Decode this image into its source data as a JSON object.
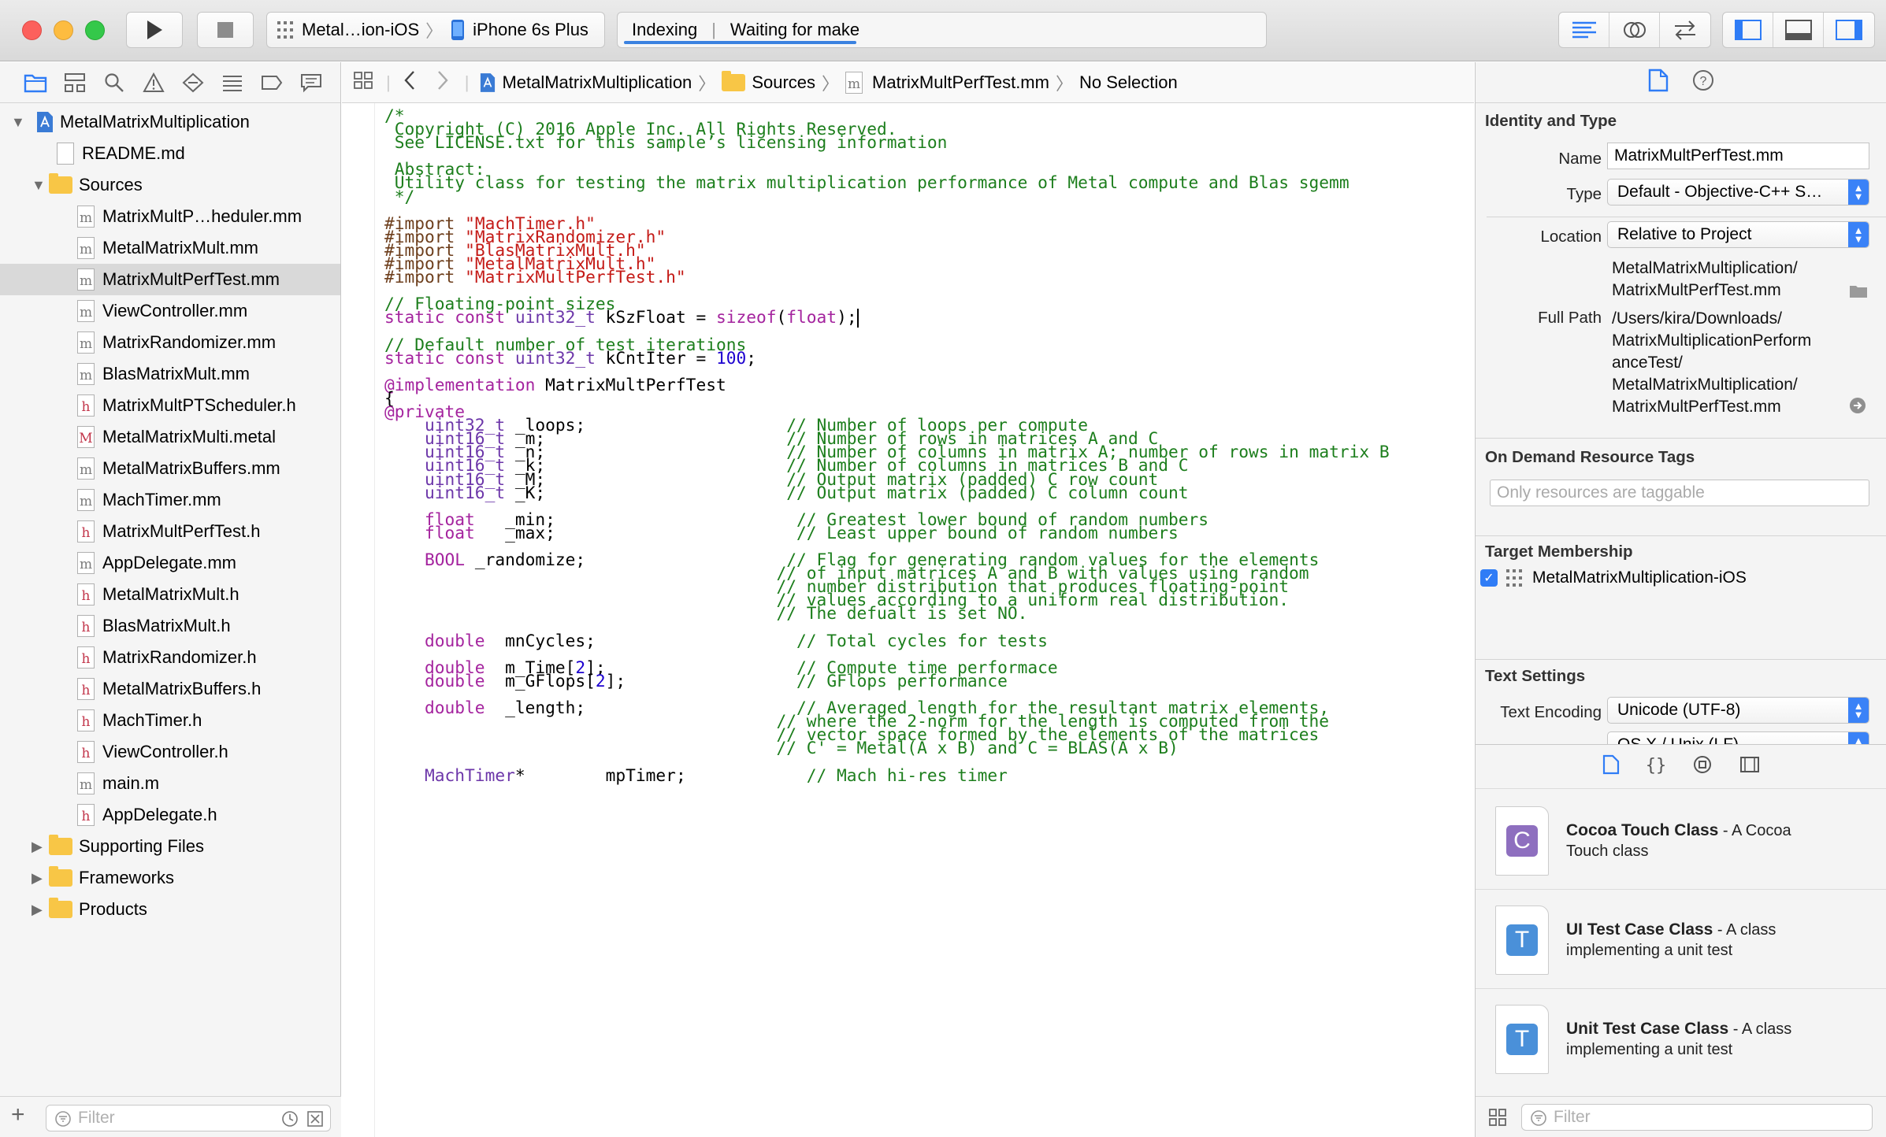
{
  "toolbar": {
    "scheme_name": "Metal…ion-iOS",
    "device_name": "iPhone 6s Plus",
    "status_left": "Indexing",
    "status_right": "Waiting for make"
  },
  "navigator": {
    "project": "MetalMatrixMultiplication",
    "readme": "README.md",
    "sources_folder": "Sources",
    "files": [
      {
        "name": "MatrixMultP…heduler.mm",
        "kind": "m"
      },
      {
        "name": "MetalMatrixMult.mm",
        "kind": "m"
      },
      {
        "name": "MatrixMultPerfTest.mm",
        "kind": "m",
        "selected": true
      },
      {
        "name": "ViewController.mm",
        "kind": "m"
      },
      {
        "name": "MatrixRandomizer.mm",
        "kind": "m"
      },
      {
        "name": "BlasMatrixMult.mm",
        "kind": "m"
      },
      {
        "name": "MatrixMultPTScheduler.h",
        "kind": "h"
      },
      {
        "name": "MetalMatrixMulti.metal",
        "kind": "metal"
      },
      {
        "name": "MetalMatrixBuffers.mm",
        "kind": "m"
      },
      {
        "name": "MachTimer.mm",
        "kind": "m"
      },
      {
        "name": "MatrixMultPerfTest.h",
        "kind": "h"
      },
      {
        "name": "AppDelegate.mm",
        "kind": "m"
      },
      {
        "name": "MetalMatrixMult.h",
        "kind": "h"
      },
      {
        "name": "BlasMatrixMult.h",
        "kind": "h"
      },
      {
        "name": "MatrixRandomizer.h",
        "kind": "h"
      },
      {
        "name": "MetalMatrixBuffers.h",
        "kind": "h"
      },
      {
        "name": "MachTimer.h",
        "kind": "h"
      },
      {
        "name": "ViewController.h",
        "kind": "h"
      },
      {
        "name": "main.m",
        "kind": "m"
      },
      {
        "name": "AppDelegate.h",
        "kind": "h"
      }
    ],
    "groups": [
      "Supporting Files",
      "Frameworks",
      "Products"
    ],
    "filter_placeholder": "Filter"
  },
  "jumpbar": {
    "project": "MetalMatrixMultiplication",
    "folder": "Sources",
    "file": "MatrixMultPerfTest.mm",
    "selection": "No Selection"
  },
  "editor": {
    "lines": [
      [
        [
          "cm",
          "/*"
        ]
      ],
      [
        [
          "cm",
          " Copyright (C) 2016 Apple Inc. All Rights Reserved."
        ]
      ],
      [
        [
          "cm",
          " See LICENSE.txt for this sample’s licensing information"
        ]
      ],
      [
        [
          "cm",
          " "
        ]
      ],
      [
        [
          "cm",
          " Abstract:"
        ]
      ],
      [
        [
          "cm",
          " Utility class for testing the matrix multiplication performance of Metal compute and Blas sgemm"
        ]
      ],
      [
        [
          "cm",
          " */"
        ]
      ],
      [
        [
          "",
          ""
        ]
      ],
      [
        [
          "pp",
          "#import "
        ],
        [
          "st",
          "\"MachTimer.h\""
        ]
      ],
      [
        [
          "pp",
          "#import "
        ],
        [
          "st",
          "\"MatrixRandomizer.h\""
        ]
      ],
      [
        [
          "pp",
          "#import "
        ],
        [
          "st",
          "\"BlasMatrixMult.h\""
        ]
      ],
      [
        [
          "pp",
          "#import "
        ],
        [
          "st",
          "\"MetalMatrixMult.h\""
        ]
      ],
      [
        [
          "pp",
          "#import "
        ],
        [
          "st",
          "\"MatrixMultPerfTest.h\""
        ]
      ],
      [
        [
          "",
          ""
        ]
      ],
      [
        [
          "cm",
          "// Floating-point sizes"
        ]
      ],
      [
        [
          "kw",
          "static const "
        ],
        [
          "ty",
          "uint32_t"
        ],
        [
          "",
          " kSzFloat = "
        ],
        [
          "kw",
          "sizeof"
        ],
        [
          "",
          "("
        ],
        [
          "kw",
          "float"
        ],
        [
          "",
          ");"
        ],
        [
          "cursor",
          ""
        ]
      ],
      [
        [
          "",
          ""
        ]
      ],
      [
        [
          "cm",
          "// Default number of test iterations"
        ]
      ],
      [
        [
          "kw",
          "static const "
        ],
        [
          "ty",
          "uint32_t"
        ],
        [
          "",
          " kCntIter = "
        ],
        [
          "nm",
          "100"
        ],
        [
          "",
          ";"
        ]
      ],
      [
        [
          "",
          ""
        ]
      ],
      [
        [
          "kw",
          "@implementation"
        ],
        [
          "",
          " MatrixMultPerfTest"
        ]
      ],
      [
        [
          "",
          "{"
        ]
      ],
      [
        [
          "kw",
          "@private"
        ]
      ],
      [
        [
          "",
          "    "
        ],
        [
          "ty",
          "uint32_t"
        ],
        [
          "",
          " _loops;                    "
        ],
        [
          "cm",
          "// Number of loops per compute"
        ]
      ],
      [
        [
          "",
          "    "
        ],
        [
          "ty",
          "uint16_t"
        ],
        [
          "",
          " _m;                        "
        ],
        [
          "cm",
          "// Number of rows in matrices A and C"
        ]
      ],
      [
        [
          "",
          "    "
        ],
        [
          "ty",
          "uint16_t"
        ],
        [
          "",
          " _n;                        "
        ],
        [
          "cm",
          "// Number of columns in matrix A; number of rows in matrix B"
        ]
      ],
      [
        [
          "",
          "    "
        ],
        [
          "ty",
          "uint16_t"
        ],
        [
          "",
          " _k;                        "
        ],
        [
          "cm",
          "// Number of columns in matrices B and C"
        ]
      ],
      [
        [
          "",
          "    "
        ],
        [
          "ty",
          "uint16_t"
        ],
        [
          "",
          " _M;                        "
        ],
        [
          "cm",
          "// Output matrix (padded) C row count"
        ]
      ],
      [
        [
          "",
          "    "
        ],
        [
          "ty",
          "uint16_t"
        ],
        [
          "",
          " _K;                        "
        ],
        [
          "cm",
          "// Output matrix (padded) C column count"
        ]
      ],
      [
        [
          "",
          ""
        ]
      ],
      [
        [
          "",
          "    "
        ],
        [
          "kw",
          "float"
        ],
        [
          "",
          "   _min;                        "
        ],
        [
          "cm",
          "// Greatest lower bound of random numbers"
        ]
      ],
      [
        [
          "",
          "    "
        ],
        [
          "kw",
          "float"
        ],
        [
          "",
          "   _max;                        "
        ],
        [
          "cm",
          "// Least upper bound of random numbers"
        ]
      ],
      [
        [
          "",
          ""
        ]
      ],
      [
        [
          "",
          "    "
        ],
        [
          "kw",
          "BOOL"
        ],
        [
          "",
          " _randomize;                    "
        ],
        [
          "cm",
          "// Flag for generating random values for the elements"
        ]
      ],
      [
        [
          "",
          "                                       "
        ],
        [
          "cm",
          "// of input matrices A and B with values using random"
        ]
      ],
      [
        [
          "",
          "                                       "
        ],
        [
          "cm",
          "// number distribution that produces floating-point"
        ]
      ],
      [
        [
          "",
          "                                       "
        ],
        [
          "cm",
          "// values according to a uniform real distribution."
        ]
      ],
      [
        [
          "",
          "                                       "
        ],
        [
          "cm",
          "// The defualt is set NO."
        ]
      ],
      [
        [
          "",
          ""
        ]
      ],
      [
        [
          "",
          "    "
        ],
        [
          "kw",
          "double"
        ],
        [
          "",
          "  mnCycles;                    "
        ],
        [
          "cm",
          "// Total cycles for tests"
        ]
      ],
      [
        [
          "",
          ""
        ]
      ],
      [
        [
          "",
          "    "
        ],
        [
          "kw",
          "double"
        ],
        [
          "",
          "  m_Time["
        ],
        [
          "nm",
          "2"
        ],
        [
          "",
          "];                   "
        ],
        [
          "cm",
          "// Compute time performace"
        ]
      ],
      [
        [
          "",
          "    "
        ],
        [
          "kw",
          "double"
        ],
        [
          "",
          "  m_GFlops["
        ],
        [
          "nm",
          "2"
        ],
        [
          "",
          "];                 "
        ],
        [
          "cm",
          "// GFlops performance"
        ]
      ],
      [
        [
          "",
          ""
        ]
      ],
      [
        [
          "",
          "    "
        ],
        [
          "kw",
          "double"
        ],
        [
          "",
          "  _length;                     "
        ],
        [
          "cm",
          "// Averaged length for the resultant matrix elements,"
        ]
      ],
      [
        [
          "",
          "                                       "
        ],
        [
          "cm",
          "// where the 2-norm for the length is computed from the"
        ]
      ],
      [
        [
          "",
          "                                       "
        ],
        [
          "cm",
          "// vector space formed by the elements of the matrices"
        ]
      ],
      [
        [
          "",
          "                                       "
        ],
        [
          "cm",
          "// C' = Metal(A x B) and C = BLAS(A x B)"
        ]
      ],
      [
        [
          "",
          ""
        ]
      ],
      [
        [
          "",
          "    "
        ],
        [
          "ty",
          "MachTimer"
        ],
        [
          "",
          "*        mpTimer;            "
        ],
        [
          "cm",
          "// Mach hi-res timer"
        ]
      ]
    ]
  },
  "inspector": {
    "identity_title": "Identity and Type",
    "name_label": "Name",
    "name_value": "MatrixMultPerfTest.mm",
    "type_label": "Type",
    "type_value": "Default - Objective-C++ S…",
    "location_label": "Location",
    "location_value": "Relative to Project",
    "location_path_1": "MetalMatrixMultiplication/",
    "location_path_2": "MatrixMultPerfTest.mm",
    "fullpath_label": "Full Path",
    "fullpath_lines": [
      "/Users/kira/Downloads/",
      "MatrixMultiplicationPerform",
      "anceTest/",
      "MetalMatrixMultiplication/",
      "MatrixMultPerfTest.mm"
    ],
    "odr_title": "On Demand Resource Tags",
    "odr_placeholder": "Only resources are taggable",
    "target_title": "Target Membership",
    "target_name": "MetalMatrixMultiplication-iOS",
    "text_title": "Text Settings",
    "encoding_label": "Text Encoding",
    "encoding_value": "Unicode (UTF-8)",
    "line_endings_partial": "OS X / Unix (LF)"
  },
  "library": {
    "items": [
      {
        "title": "Cocoa Touch Class",
        "desc": " - A Cocoa Touch class",
        "letter": "C",
        "color": "#8e6fbf"
      },
      {
        "title": "UI Test Case Class",
        "desc": " - A class implementing a unit test",
        "letter": "T",
        "color": "#4a90d9"
      },
      {
        "title": "Unit Test Case Class",
        "desc": " - A class implementing a unit test",
        "letter": "T",
        "color": "#4a90d9"
      }
    ],
    "filter_placeholder": "Filter"
  }
}
